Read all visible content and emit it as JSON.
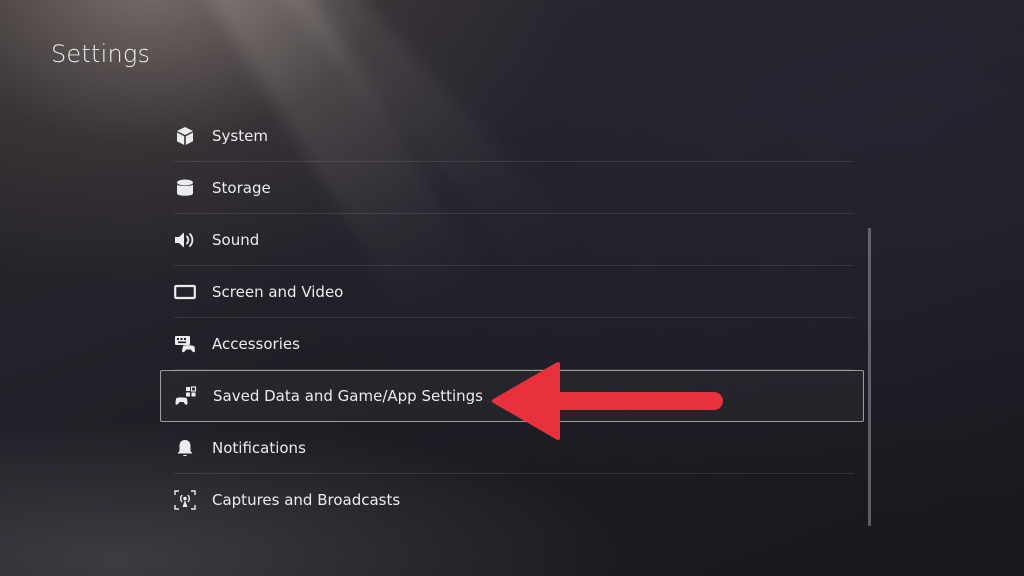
{
  "header": {
    "title": "Settings"
  },
  "menu": {
    "items": [
      {
        "label": "System",
        "icon": "system-cube-icon"
      },
      {
        "label": "Storage",
        "icon": "storage-cylinder-icon"
      },
      {
        "label": "Sound",
        "icon": "speaker-icon"
      },
      {
        "label": "Screen and Video",
        "icon": "screen-icon"
      },
      {
        "label": "Accessories",
        "icon": "keyboard-controller-icon"
      },
      {
        "label": "Saved Data and Game/App Settings",
        "icon": "controller-data-icon",
        "selected": true
      },
      {
        "label": "Notifications",
        "icon": "bell-icon"
      },
      {
        "label": "Captures and Broadcasts",
        "icon": "broadcast-icon"
      }
    ]
  },
  "annotation": {
    "arrow_color": "#e8313d"
  },
  "colors": {
    "text": "#ececef",
    "selected_border": "#ffffff"
  }
}
